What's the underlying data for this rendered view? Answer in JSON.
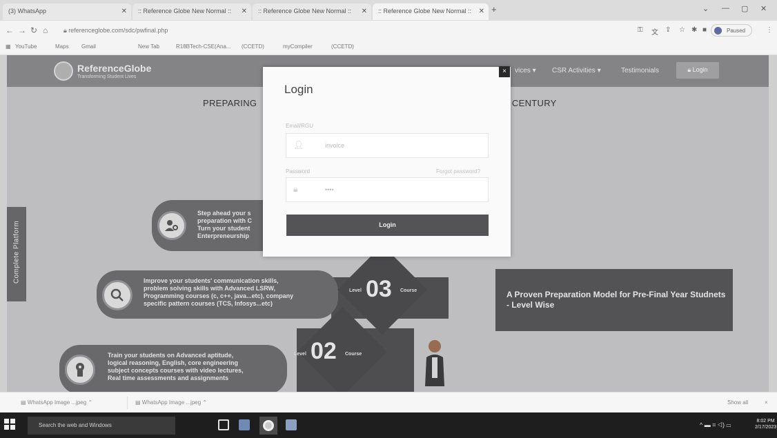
{
  "browser": {
    "tabs": [
      {
        "label": "(3) WhatsApp",
        "active": false
      },
      {
        "label": ":: Reference Globe New Normal ::",
        "active": false
      },
      {
        "label": ":: Reference Globe New Normal ::",
        "active": false
      },
      {
        "label": ":: Reference Globe New Normal ::",
        "active": true
      }
    ],
    "new_tab": "+",
    "url": "referenceglobe.com/sdc/pwfinal.php",
    "profile": "Paused",
    "bookmarks": [
      "YouTube",
      "Maps",
      "Gmail",
      "",
      "New Tab",
      "R18BTech-CSE(Ana...",
      "(CCETD)",
      "myCompiler",
      "(CCETD)"
    ]
  },
  "site": {
    "logo_name": "ReferenceGlobe",
    "logo_tagline": "Transforming Student Lives",
    "nav": {
      "services": "vices",
      "csr": "CSR Activities",
      "testimonials": "Testimonials",
      "login": "Login"
    },
    "headline_left": "PREPARING",
    "headline_right": "T CENTURY",
    "side_tab": "Complete Platform",
    "level4_lines": [
      "Step ahead your s",
      "preparation with C",
      "Turn your student",
      "Enterpreneurship"
    ],
    "level3_lines": [
      "Improve your students' communication skills,",
      "problem solving skills with Advanced LSRW,",
      "Programming courses (c, c++, java...etc), company",
      "specific pattern courses (TCS, Infosys...etc)"
    ],
    "level2_lines": [
      "Train your students on Advanced aptitude,",
      "logical reasoning, English, core engineering",
      "subject concepts courses with video lectures,",
      "Real time assessments and assignments"
    ],
    "level3": {
      "prefix": "Level",
      "number": "03",
      "suffix": "Course"
    },
    "level2": {
      "prefix": "Level",
      "number": "02",
      "suffix": "Course"
    },
    "proven": "A Proven Preparation Model for Pre-Final Year Studnets - Level Wise"
  },
  "modal": {
    "title": "Login",
    "close": "×",
    "email_label": "Email/RGU",
    "email_value": "invoice",
    "password_label": "Password",
    "forgot": "Forgot password?",
    "password_value": "••••",
    "button": "Login"
  },
  "downloads": {
    "items": [
      "WhatsApp Image ...jpeg",
      "WhatsApp Image ...jpeg"
    ],
    "show_all": "Show all",
    "close": "×"
  },
  "taskbar": {
    "search_placeholder": "Search the web and Windows",
    "time": "8:02 PM",
    "date": "2/17/2023"
  }
}
